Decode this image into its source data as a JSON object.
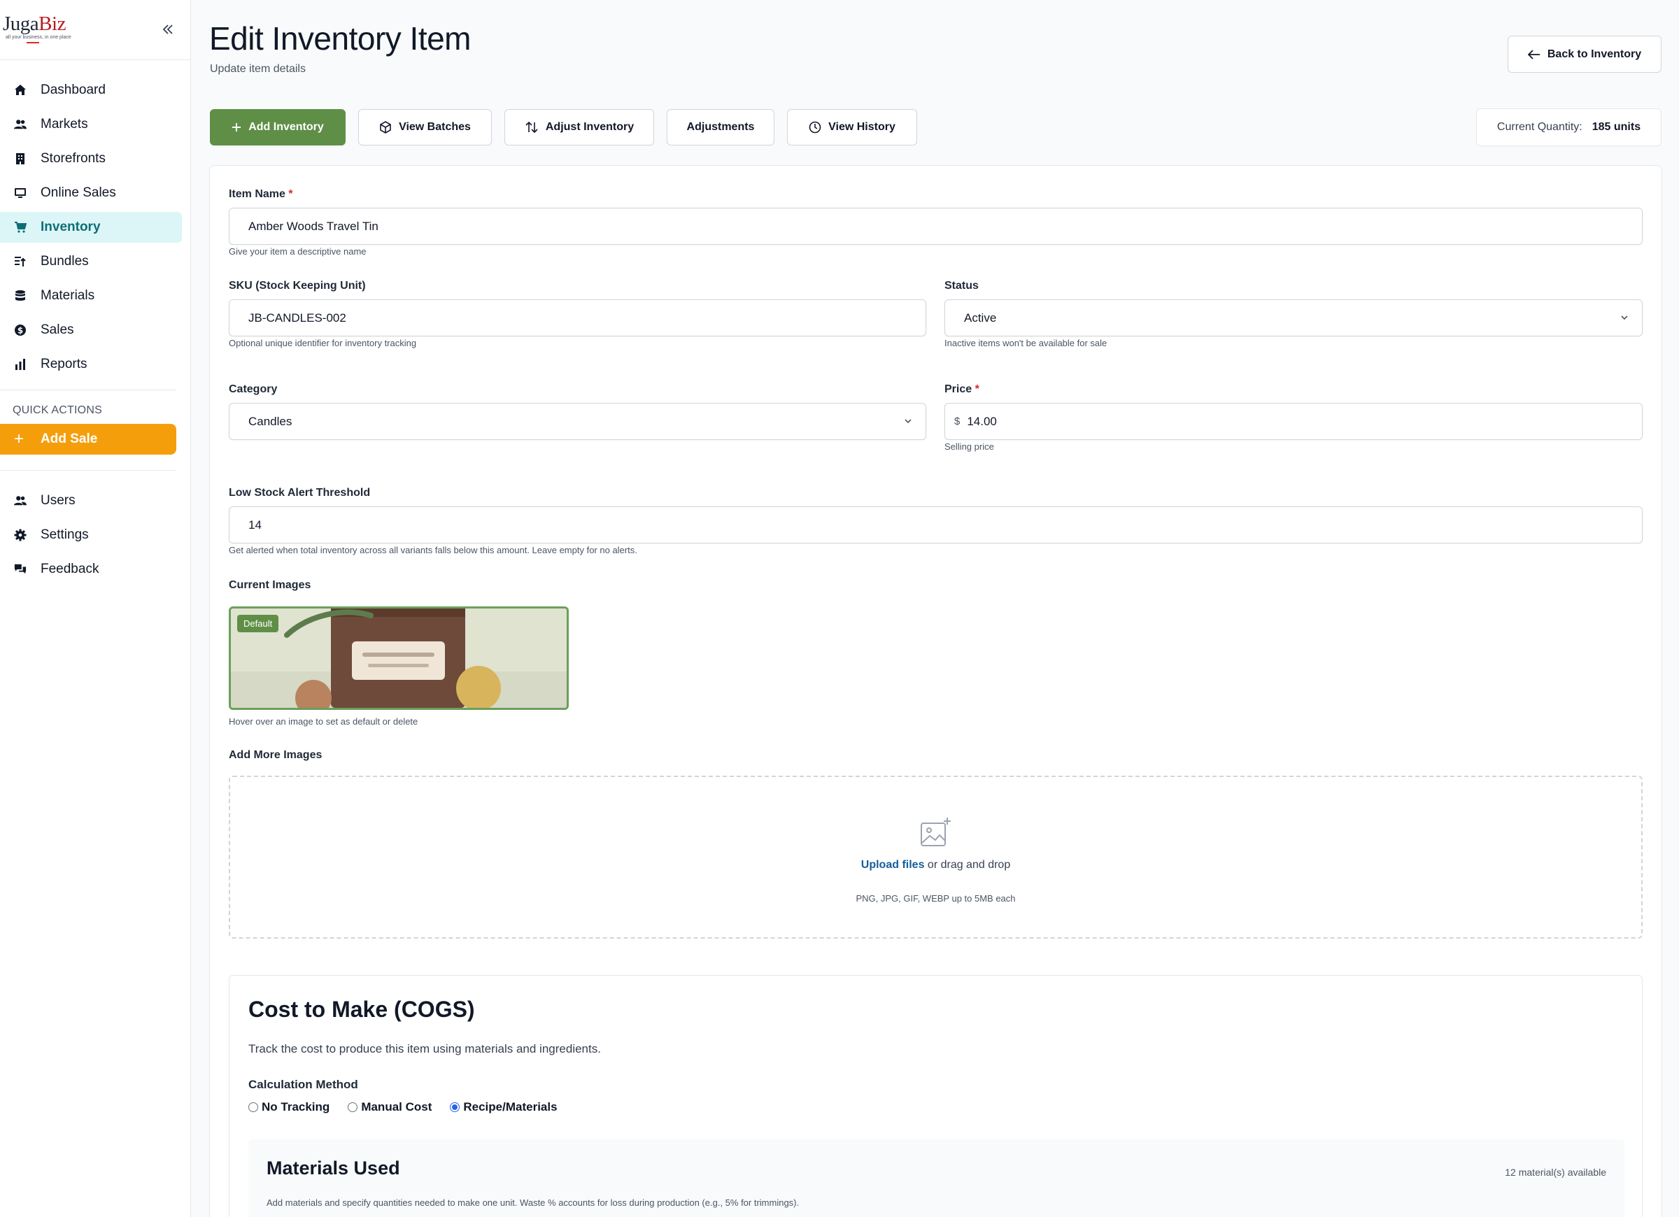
{
  "brand": {
    "name_part1": "Juga",
    "name_part2": "Biz",
    "tagline": "all your business, in one place"
  },
  "sidebar": {
    "items": [
      {
        "label": "Dashboard",
        "icon": "home-icon"
      },
      {
        "label": "Markets",
        "icon": "people-icon"
      },
      {
        "label": "Storefronts",
        "icon": "building-icon"
      },
      {
        "label": "Online Sales",
        "icon": "monitor-icon"
      },
      {
        "label": "Inventory",
        "icon": "cart-icon",
        "active": true
      },
      {
        "label": "Bundles",
        "icon": "bundle-icon"
      },
      {
        "label": "Materials",
        "icon": "database-icon"
      },
      {
        "label": "Sales",
        "icon": "dollar-icon"
      },
      {
        "label": "Reports",
        "icon": "bar-chart-icon"
      }
    ],
    "quick_actions_label": "QUICK ACTIONS",
    "add_sale_label": "Add Sale",
    "bottom_items": [
      {
        "label": "Users",
        "icon": "people-icon"
      },
      {
        "label": "Settings",
        "icon": "gear-icon"
      },
      {
        "label": "Feedback",
        "icon": "chat-icon"
      }
    ]
  },
  "header": {
    "title": "Edit Inventory Item",
    "subtitle": "Update item details",
    "back_label": "Back to Inventory"
  },
  "toolbar": {
    "add_inventory": "Add Inventory",
    "view_batches": "View Batches",
    "adjust_inventory": "Adjust Inventory",
    "adjustments": "Adjustments",
    "view_history": "View History",
    "current_quantity_label": "Current Quantity:",
    "current_quantity_value": "185 units"
  },
  "form": {
    "item_name": {
      "label": "Item Name",
      "value": "Amber Woods Travel Tin",
      "help": "Give your item a descriptive name"
    },
    "sku": {
      "label": "SKU (Stock Keeping Unit)",
      "value": "JB-CANDLES-002",
      "help": "Optional unique identifier for inventory tracking"
    },
    "status": {
      "label": "Status",
      "value": "Active",
      "help": "Inactive items won't be available for sale"
    },
    "category": {
      "label": "Category",
      "value": "Candles"
    },
    "price": {
      "label": "Price",
      "currency": "$",
      "value": "14.00",
      "help": "Selling price"
    },
    "low_stock": {
      "label": "Low Stock Alert Threshold",
      "value": "14",
      "help": "Get alerted when total inventory across all variants falls below this amount. Leave empty for no alerts."
    },
    "current_images": {
      "label": "Current Images",
      "default_badge": "Default",
      "help": "Hover over an image to set as default or delete"
    },
    "add_images": {
      "label": "Add More Images",
      "upload_link": "Upload files",
      "upload_text": " or drag and drop",
      "formats": "PNG, JPG, GIF, WEBP up to 5MB each"
    }
  },
  "cogs": {
    "title": "Cost to Make (COGS)",
    "description": "Track the cost to produce this item using materials and ingredients.",
    "method_label": "Calculation Method",
    "options": [
      "No Tracking",
      "Manual Cost",
      "Recipe/Materials"
    ],
    "selected": "Recipe/Materials",
    "materials_title": "Materials Used",
    "materials_count": "12 material(s) available",
    "materials_desc": "Add materials and specify quantities needed to make one unit. Waste % accounts for loss during production (e.g., 5% for trimmings)."
  }
}
